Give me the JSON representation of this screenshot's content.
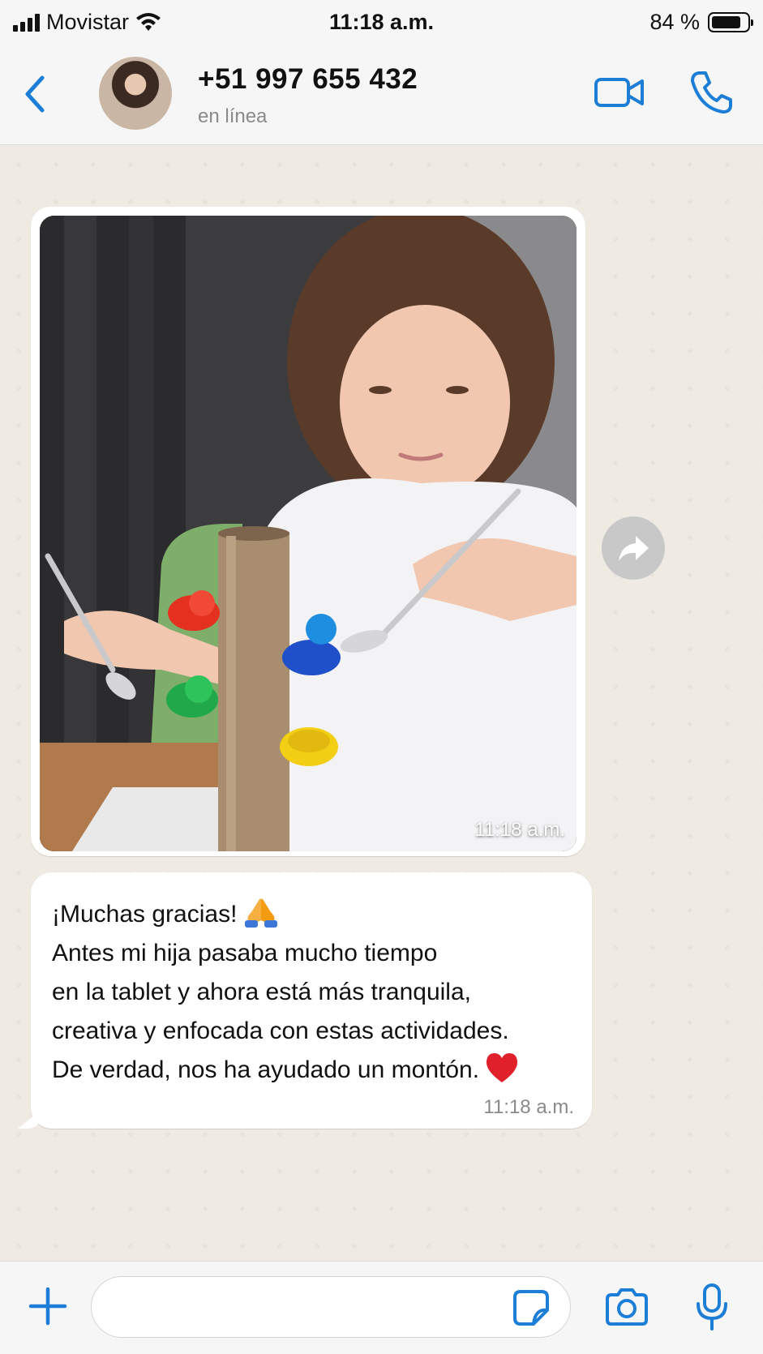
{
  "status_bar": {
    "carrier": "Movistar",
    "time": "11:18 a.m.",
    "battery": "84 %",
    "battery_level": 0.84
  },
  "header": {
    "contact_name": "+51 997 655 432",
    "contact_status": "en línea",
    "icons": [
      "back-chevron-icon",
      "video-call-icon",
      "phone-icon"
    ]
  },
  "messages": [
    {
      "type": "image",
      "time": "11:18 a.m."
    },
    {
      "type": "text",
      "lines": [
        "¡Muchas gracias!",
        "Antes mi hija pasaba mucho tiempo",
        "en la tablet y ahora está más tranquila,",
        "creativa y enfocada con estas actividades.",
        "De verdad, nos ha ayudado un montón."
      ],
      "emojis": [
        "folded-hands",
        "red-heart"
      ],
      "time": "11:18 a.m."
    }
  ],
  "composer": {
    "placeholder": "",
    "icons": [
      "plus-icon",
      "sticker-icon",
      "camera-icon",
      "microphone-icon"
    ]
  },
  "colors": {
    "accent": "#1c7ed6",
    "chat_bg": "#efeae2",
    "bubble": "#ffffff"
  }
}
